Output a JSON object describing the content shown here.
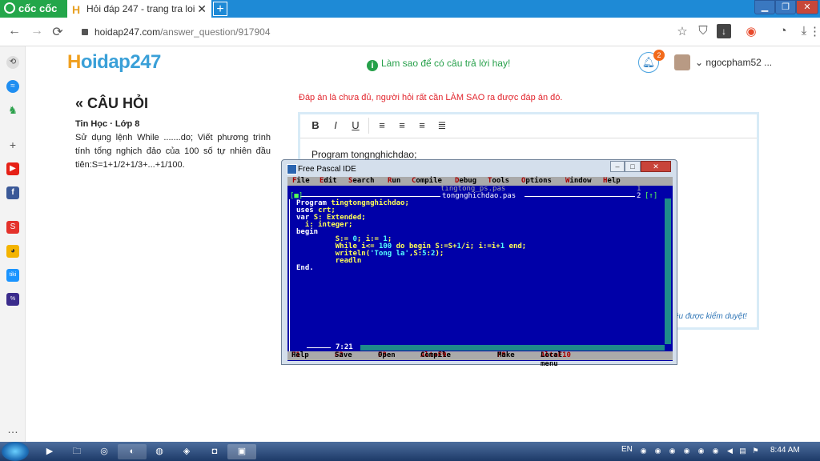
{
  "browser": {
    "brand": "cốc cốc",
    "tab_title": "Hỏi đáp 247 - trang tra loi",
    "tab_close": "✕",
    "new_tab": "+",
    "url_host": "hoidap247.com",
    "url_path": "/answer_question/917904",
    "nav_back": "←",
    "nav_forward": "→",
    "nav_reload": "⟳",
    "min": "▁",
    "max": "❐",
    "close": "✕"
  },
  "page": {
    "logo_h": "H",
    "logo_text": "oidap247",
    "howto_icon": "i",
    "howto_text": "Làm sao để có câu trả lời hay!",
    "notif_count": "2",
    "username": "ngocpham52 ...",
    "question_heading": "« CÂU HỎI",
    "subject": "Tin Học · Lớp 8",
    "question_text": "Sử dụng lệnh While .......do; Viết phương trình tính tổng nghịch đảo của 100 số tự nhiên đầu tiên:S=1+1/2+1/3+...+1/100.",
    "warning": "Đáp án là chưa đủ, người hỏi rất cần LÀM SAO ra được đáp án đó.",
    "editor_text": "Program tongnghichdao;",
    "review_text": "ều được kiểm duyệt!",
    "toolbar": {
      "bold": "B",
      "italic": "I",
      "underline": "U"
    }
  },
  "fp_ide": {
    "title": "Free Pascal IDE",
    "menu": [
      {
        "hk": "F",
        "rest": "ile"
      },
      {
        "hk": "E",
        "rest": "dit"
      },
      {
        "hk": "S",
        "rest": "earch"
      },
      {
        "hk": "R",
        "rest": "un"
      },
      {
        "hk": "C",
        "rest": "ompile"
      },
      {
        "hk": "D",
        "rest": "ebug"
      },
      {
        "hk": "T",
        "rest": "ools"
      },
      {
        "hk": "O",
        "rest": "ptions"
      },
      {
        "hk": "W",
        "rest": "indow"
      },
      {
        "hk": "H",
        "rest": "elp"
      }
    ],
    "file1": "tingtong_ps.pas",
    "file2": "tongnghichdao.pas",
    "win1_no": "1",
    "win2_no": "2",
    "code": {
      "l1a": "Program ",
      "l1b": "tingtongnghichdao;",
      "l2a": "uses ",
      "l2b": "crt;",
      "l3a": "var ",
      "l3b": "S: Extended;",
      "l4": "  i: integer;",
      "l5": "begin",
      "l6a": "         S:= ",
      "l6b": "0",
      "l6c": "; i:= ",
      "l6d": "1",
      "l6e": ";",
      "l7a": "         While i<= ",
      "l7b": "100",
      "l7c": " do begin S:=S+",
      "l7d": "1",
      "l7e": "/i; i:=i+",
      "l7f": "1",
      "l7g": " end;",
      "l8a": "         writeln(",
      "l8b": "'Tong la'",
      "l8c": ",S:",
      "l8d": "5",
      "l8e": ":",
      "l8f": "2",
      "l8g": ");",
      "l9": "         readln",
      "l10": "End."
    },
    "cursor_pos": "7:21",
    "status": [
      {
        "hk": "F1",
        "rest": " Help"
      },
      {
        "hk": "F2",
        "rest": " Save"
      },
      {
        "hk": "F3",
        "rest": " Open"
      },
      {
        "hk": "Alt+F9",
        "rest": " Compile"
      },
      {
        "hk": "F9",
        "rest": " Make"
      },
      {
        "hk": "Alt+F10",
        "rest": " Local menu"
      }
    ]
  },
  "taskbar": {
    "lang": "EN",
    "clock": "8:44 AM"
  },
  "colors": {
    "coccoc_green": "#23a64a",
    "tabbar_blue": "#1e8ad6",
    "fp_blue": "#0000a8",
    "warn_red": "#e2262e"
  }
}
